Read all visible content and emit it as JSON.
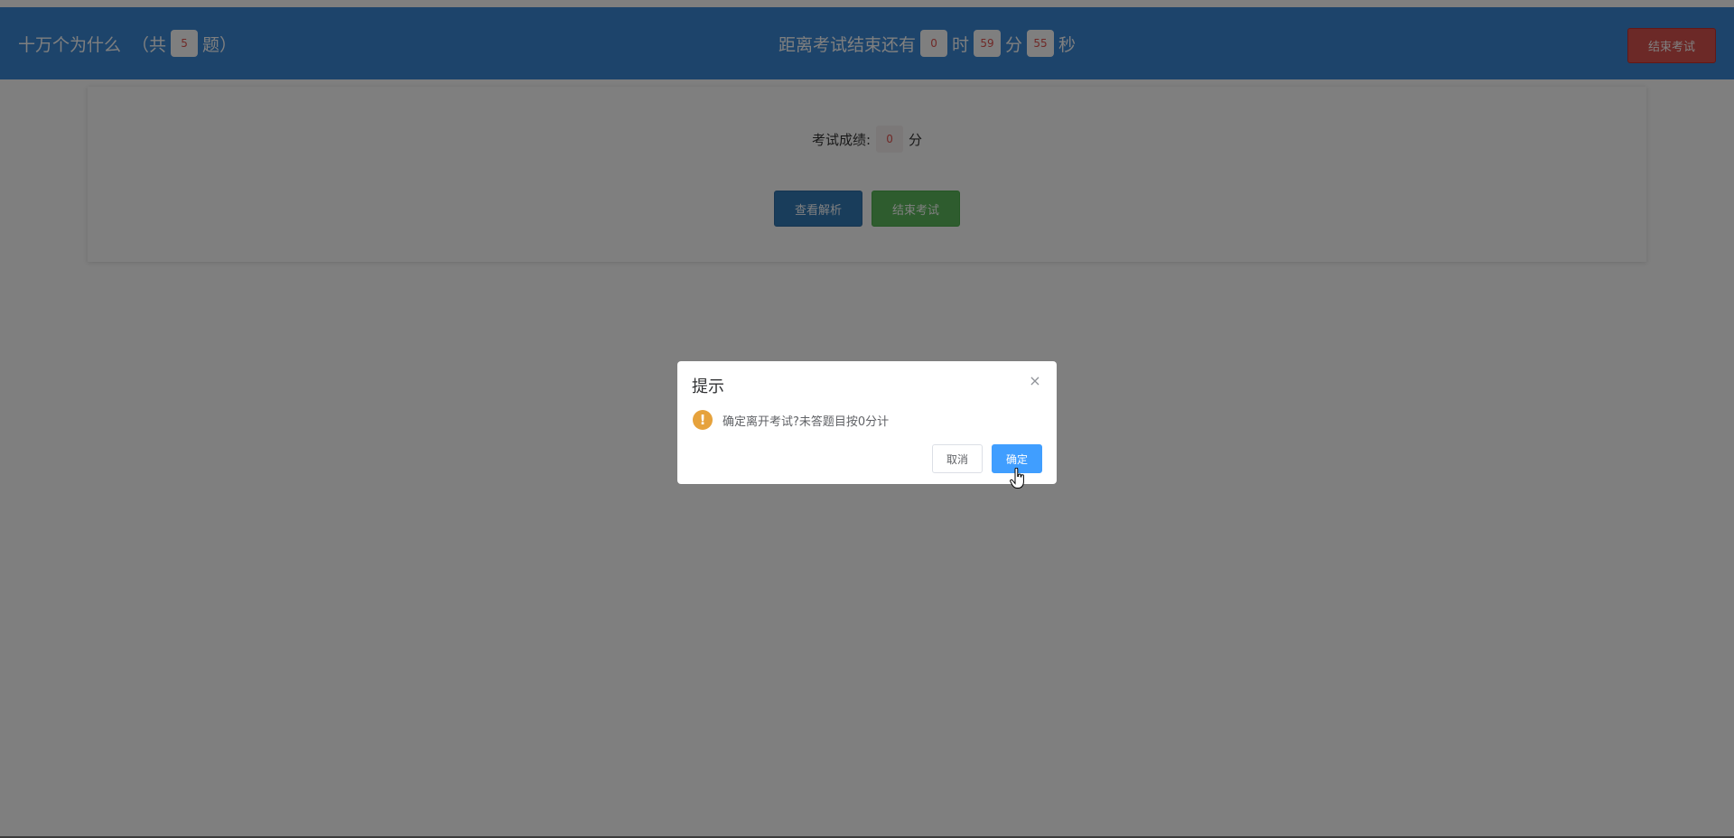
{
  "header": {
    "quiz_name": "十万个为什么",
    "count_prefix": "（共",
    "question_count": "5",
    "count_suffix": "题）",
    "timer_prefix": "距离考试结束还有",
    "hours": "0",
    "hours_unit": "时",
    "minutes": "59",
    "minutes_unit": "分",
    "seconds": "55",
    "seconds_unit": "秒",
    "end_exam_label": "结束考试"
  },
  "result": {
    "score_label": "考试成绩:",
    "score_value": "0",
    "score_unit": "分",
    "view_analysis_label": "查看解析",
    "end_exam_label": "结束考试"
  },
  "dialog": {
    "title": "提示",
    "close_glyph": "×",
    "warning_glyph": "!",
    "message": "确定离开考试?未答题目按0分计",
    "cancel_label": "取消",
    "confirm_label": "确定"
  },
  "colors": {
    "header_bg": "#3a88d6",
    "danger": "#d9534f",
    "primary": "#337ab7",
    "success": "#5cb85c",
    "dialog_confirm": "#409eff",
    "warning": "#e6a23c"
  }
}
